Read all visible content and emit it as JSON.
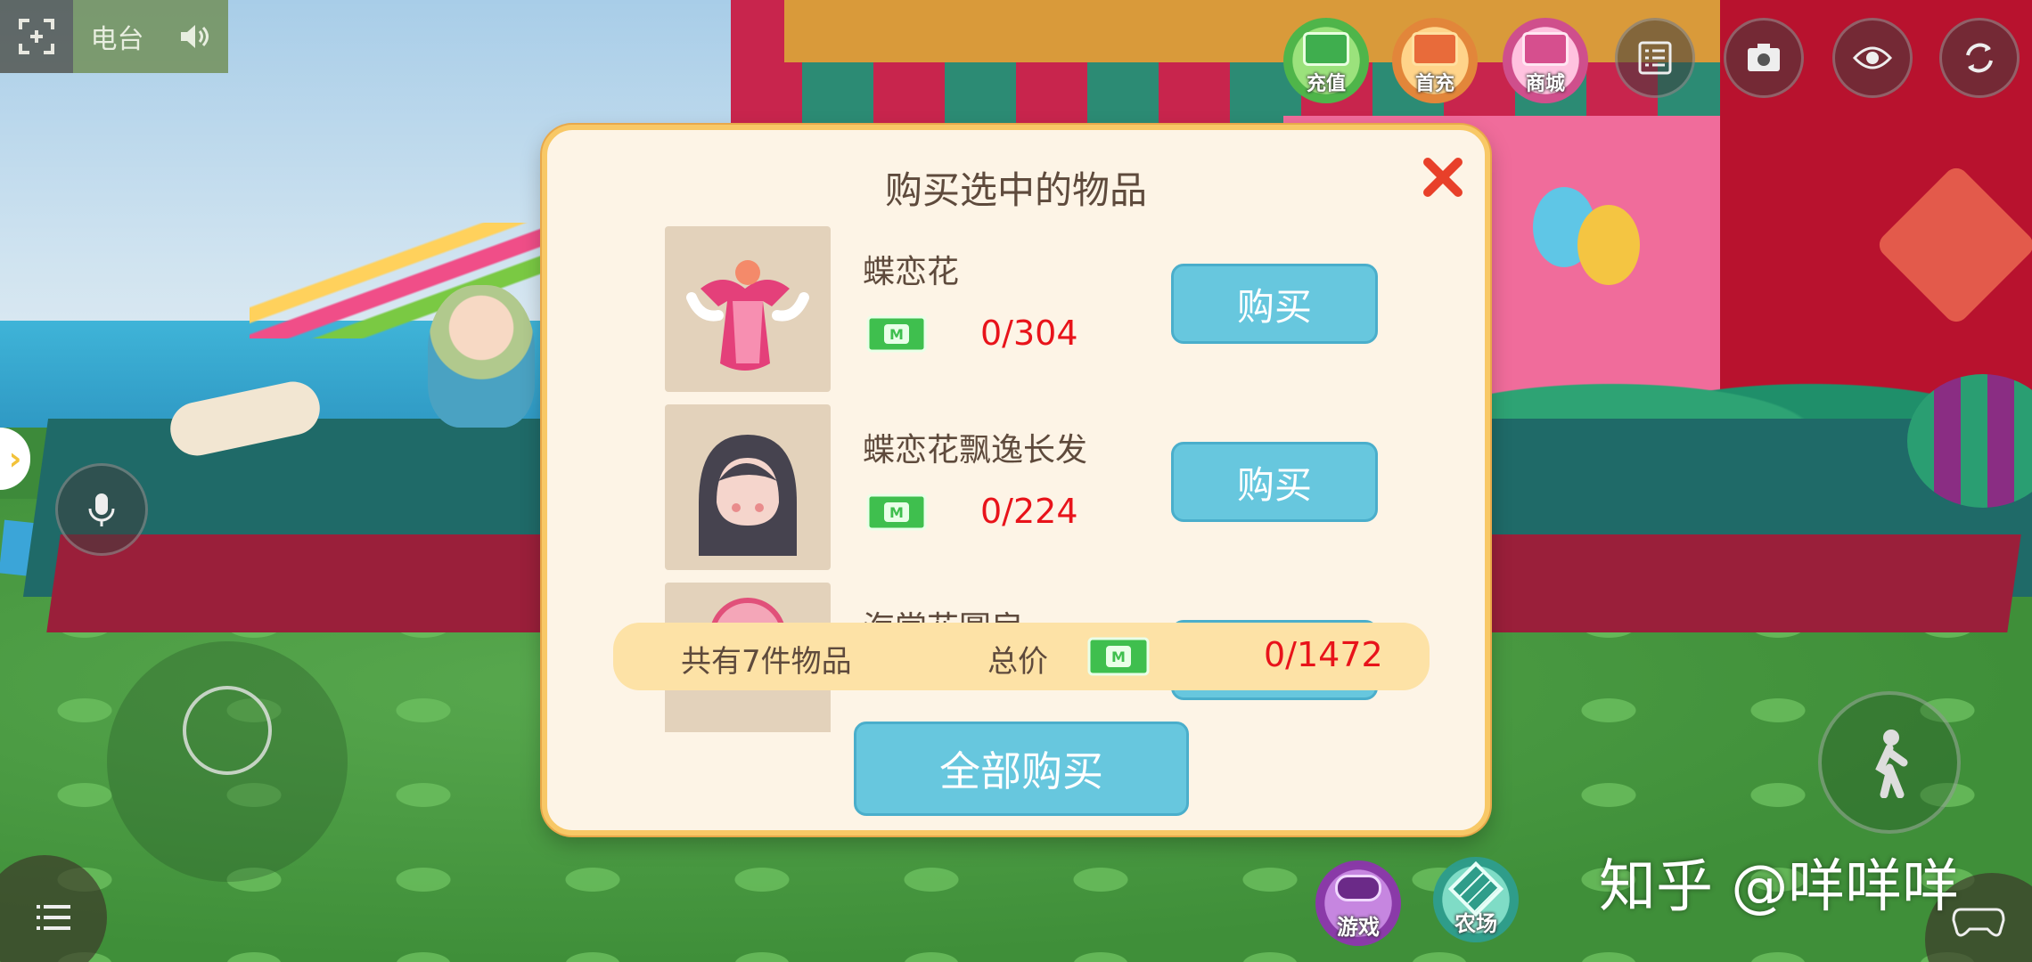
{
  "hud": {
    "radio_label": "电台",
    "shop_buttons": [
      {
        "label": "充值",
        "icon": "cash-icon",
        "color": "#3fae4e"
      },
      {
        "label": "首充",
        "icon": "gift-icon",
        "color": "#e86b3a"
      },
      {
        "label": "商城",
        "icon": "shopping-bag-icon",
        "color": "#d64f8e"
      }
    ],
    "bottom_buttons": [
      {
        "label": "游戏",
        "icon": "gamepad-icon",
        "color": "#8a3aa8"
      },
      {
        "label": "农场",
        "icon": "farm-grid-icon",
        "color": "#2f9d8a"
      }
    ]
  },
  "dialog": {
    "title": "购买选中的物品",
    "items": [
      {
        "name": "蝶恋花",
        "count": "0/304",
        "buy_label": "购买",
        "thumb": "pink-dress-icon"
      },
      {
        "name": "蝶恋花飘逸长发",
        "count": "0/224",
        "buy_label": "购买",
        "thumb": "long-hair-icon"
      },
      {
        "name": "海棠花圆扇",
        "count": "",
        "buy_label": "购买",
        "thumb": "round-fan-icon"
      }
    ],
    "summary": {
      "count_text": "共有7件物品",
      "total_label": "总价",
      "total_price": "0/1472"
    },
    "buy_all_label": "全部购买"
  },
  "watermark": "知乎 @咩咩咩",
  "colors": {
    "dialog_bg": "#fdf4e6",
    "dialog_border": "#f8c866",
    "button_blue": "#67c7de",
    "price_red": "#e8131a",
    "summary_bg": "#fde2a6"
  }
}
